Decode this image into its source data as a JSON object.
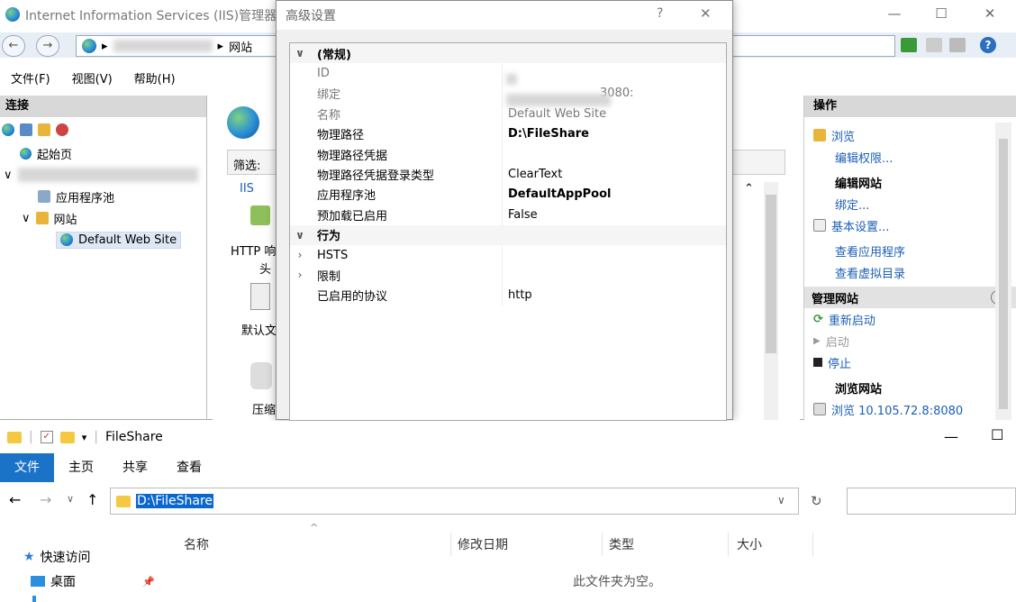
{
  "iis": {
    "title": "Internet Information Services (IIS)管理器",
    "address_tail": "网站",
    "menu": [
      "文件(F)",
      "视图(V)",
      "帮助(H)"
    ],
    "connections_title": "连接",
    "tree": {
      "start_page": "起始页",
      "app_pools": "应用程序池",
      "sites": "网站",
      "default_site": "Default Web Site"
    },
    "mid": {
      "filter_label": "筛选:",
      "group_label": "IIS",
      "features": [
        "HTTP 响",
        "头",
        "默认文",
        "压缩"
      ]
    },
    "actions": {
      "title": "操作",
      "browse": "浏览",
      "edit_perms": "编辑权限...",
      "edit_site": "编辑网站",
      "bindings": "绑定...",
      "basic_settings": "基本设置...",
      "view_apps": "查看应用程序",
      "view_vdirs": "查看虚拟目录",
      "manage_site": "管理网站",
      "restart": "重新启动",
      "start": "启动",
      "stop": "停止",
      "browse_site": "浏览网站",
      "browse_url": "浏览 10.105.72.8:8080"
    }
  },
  "dialog": {
    "title": "高级设置",
    "help": "?",
    "close": "✕",
    "rows": [
      {
        "exp": "∨",
        "key": "(常规)",
        "value": "",
        "type": "cat"
      },
      {
        "exp": "",
        "key": "ID",
        "value": "",
        "type": "gray"
      },
      {
        "exp": "",
        "key": "绑定",
        "value": "3080:",
        "type": "gray"
      },
      {
        "exp": "",
        "key": "名称",
        "value": "Default Web Site",
        "type": "gray"
      },
      {
        "exp": "",
        "key": "物理路径",
        "value": "D:\\FileShare",
        "type": "bold"
      },
      {
        "exp": "",
        "key": "物理路径凭据",
        "value": "",
        "type": "normal"
      },
      {
        "exp": "",
        "key": "物理路径凭据登录类型",
        "value": "ClearText",
        "type": "normal"
      },
      {
        "exp": "",
        "key": "应用程序池",
        "value": "DefaultAppPool",
        "type": "bold"
      },
      {
        "exp": "",
        "key": "预加载已启用",
        "value": "False",
        "type": "normal"
      },
      {
        "exp": "∨",
        "key": "行为",
        "value": "",
        "type": "cat"
      },
      {
        "exp": "›",
        "key": "HSTS",
        "value": "",
        "type": "normal"
      },
      {
        "exp": "›",
        "key": "限制",
        "value": "",
        "type": "normal"
      },
      {
        "exp": "",
        "key": "已启用的协议",
        "value": "http",
        "type": "normal"
      }
    ]
  },
  "explorer": {
    "title": "FileShare",
    "tabs": [
      "文件",
      "主页",
      "共享",
      "查看"
    ],
    "path": "D:\\FileShare",
    "columns": [
      "名称",
      "修改日期",
      "类型",
      "大小"
    ],
    "empty_text": "此文件夹为空。",
    "quick_access": "快速访问",
    "desktop": "桌面"
  }
}
